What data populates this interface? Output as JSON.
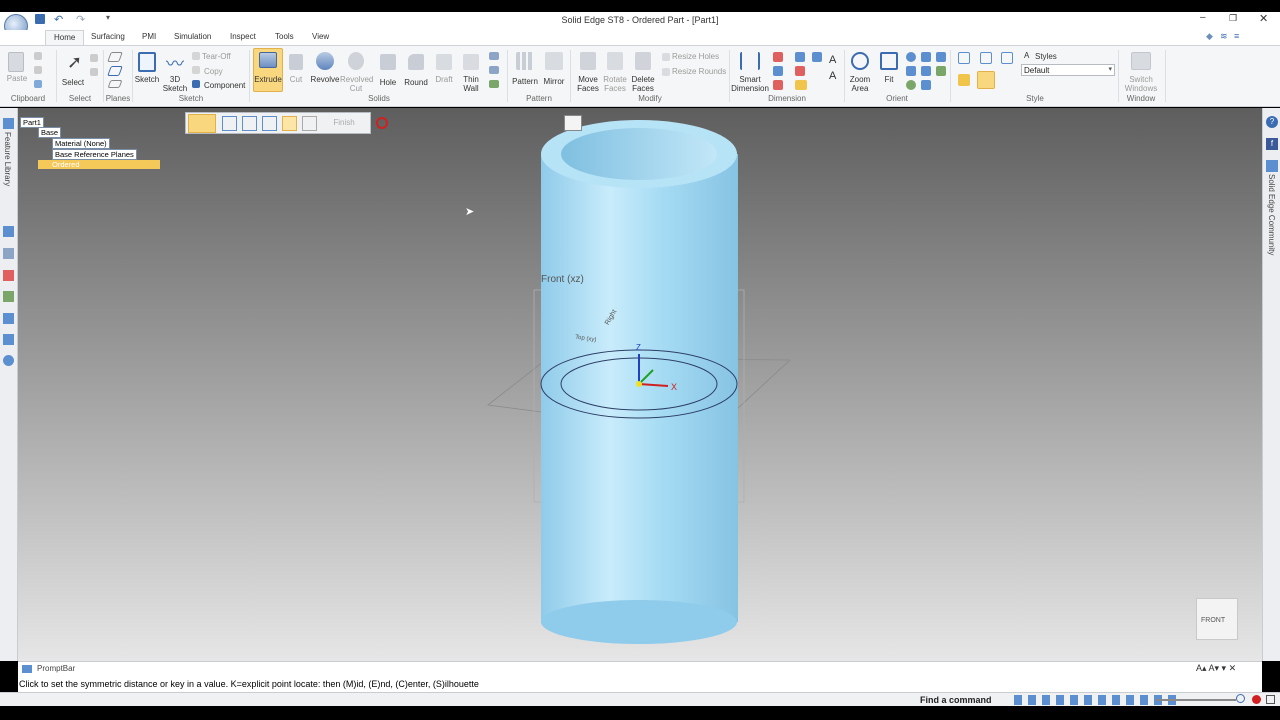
{
  "window": {
    "title": "Solid Edge ST8 - Ordered Part - [Part1]"
  },
  "tabs": [
    "Home",
    "Surfacing",
    "PMI",
    "Simulation",
    "Inspect",
    "Tools",
    "View"
  ],
  "ribbon": {
    "groups": [
      "Clipboard",
      "Select",
      "Planes",
      "Sketch",
      "Solids",
      "Pattern",
      "Modify",
      "Dimension",
      "Orient",
      "Style",
      "Window"
    ],
    "commands": {
      "paste": "Paste",
      "select": "Select",
      "sketch": "Sketch",
      "sketch3d_1": "3D",
      "sketch3d_2": "Sketch",
      "tearoff": "Tear-Off",
      "copy": "Copy",
      "component": "Component",
      "extrude": "Extrude",
      "cut": "Cut",
      "revolve": "Revolve",
      "revolved_cut_1": "Revolved",
      "revolved_cut_2": "Cut",
      "hole": "Hole",
      "round": "Round",
      "draft": "Draft",
      "thin_wall_1": "Thin",
      "thin_wall_2": "Wall",
      "pattern": "Pattern",
      "mirror": "Mirror",
      "move_faces_1": "Move",
      "move_faces_2": "Faces",
      "rotate_faces_1": "Rotate",
      "rotate_faces_2": "Faces",
      "delete_faces_1": "Delete",
      "delete_faces_2": "Faces",
      "resize_holes": "Resize Holes",
      "resize_rounds": "Resize Rounds",
      "smart_dim_1": "Smart",
      "smart_dim_2": "Dimension",
      "zoom_area_1": "Zoom",
      "zoom_area_2": "Area",
      "fit": "Fit",
      "styles": "Styles",
      "style_value": "Default",
      "switch_windows_1": "Switch",
      "switch_windows_2": "Windows"
    }
  },
  "quickbar": {
    "finish": "Finish"
  },
  "tree": {
    "root": "Part1",
    "base": "Base",
    "material": "Material (None)",
    "ref_planes": "Base Reference Planes",
    "ordered": "Ordered"
  },
  "left_panel": {
    "label": "Feature Library"
  },
  "right_panel": {
    "label": "Solid Edge Community"
  },
  "viewport": {
    "plane_front": "Front (xz)",
    "plane_right": "Right",
    "plane_top": "Top (xy)",
    "axis_z": "Z",
    "axis_x": "X",
    "view_cube": "FRONT"
  },
  "promptbar": {
    "title": "PromptBar",
    "text": "Click to set the symmetric distance or key in a value.  K=explicit point locate: then (M)id, (E)nd, (C)enter, (S)ilhouette"
  },
  "statusbar": {
    "find": "Find a command"
  },
  "colors": {
    "accent_orange": "#f7c24a",
    "part_blue": "#a9dcf5",
    "selection_yellow": "#f5d46e"
  }
}
